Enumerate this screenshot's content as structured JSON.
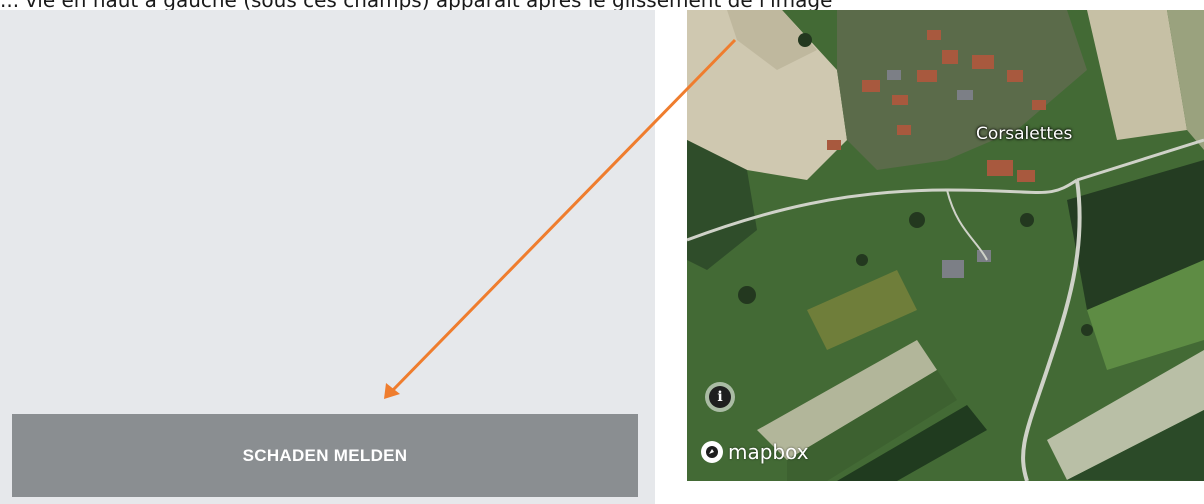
{
  "caption": "... vie en haut à gauche (sous ces champs) apparaît après le glissement de l'image",
  "report_button": {
    "label": "SCHADEN MELDEN"
  },
  "map": {
    "place_label": "Corsalettes",
    "info_glyph": "i",
    "attribution": "mapbox",
    "attribution_icon": "mapbox-logo-icon"
  },
  "annotation": {
    "color": "#ef7d2e"
  },
  "colors": {
    "left_panel": "#e6e8eb",
    "button": "#8a8e91",
    "button_text": "#ffffff"
  }
}
